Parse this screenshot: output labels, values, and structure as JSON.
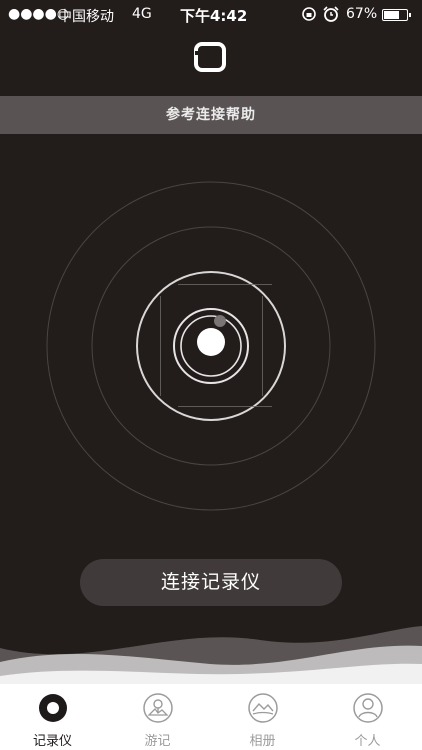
{
  "status_bar": {
    "signal": "●●●●○",
    "carrier": "中国移动",
    "network": "4G",
    "time": "下午4:42",
    "battery_percent": "67%",
    "battery_level": 0.67
  },
  "help_bar": {
    "label": "参考连接帮助"
  },
  "connect_button": {
    "label": "连接记录仪"
  },
  "tabs": [
    {
      "label": "记录仪",
      "icon": "recorder-icon",
      "active": true
    },
    {
      "label": "游记",
      "icon": "travel-notes-icon",
      "active": false
    },
    {
      "label": "相册",
      "icon": "album-icon",
      "active": false
    },
    {
      "label": "个人",
      "icon": "person-icon",
      "active": false
    }
  ],
  "colors": {
    "background": "#221c1b",
    "help_bar": "#595453",
    "button": "#403b3a",
    "tab_active": "#1e1a19",
    "tab_inactive": "#9b9b9b"
  }
}
